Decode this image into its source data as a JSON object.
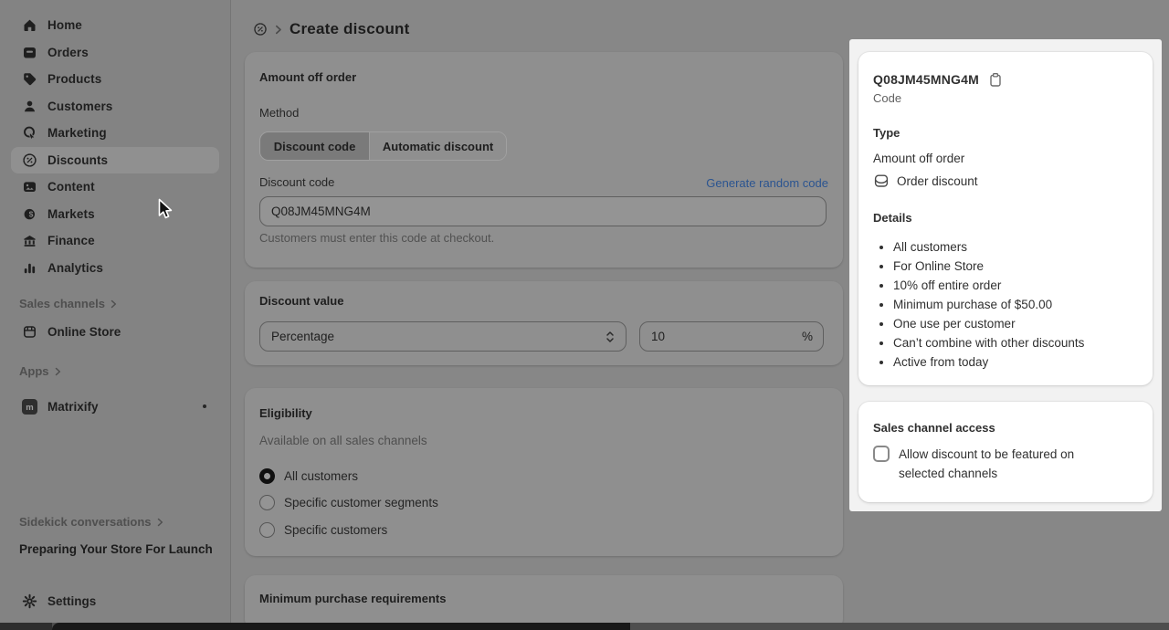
{
  "sidebar": {
    "nav": [
      {
        "label": "Home",
        "icon": "home-icon"
      },
      {
        "label": "Orders",
        "icon": "orders-icon"
      },
      {
        "label": "Products",
        "icon": "products-icon"
      },
      {
        "label": "Customers",
        "icon": "customers-icon"
      },
      {
        "label": "Marketing",
        "icon": "marketing-icon"
      },
      {
        "label": "Discounts",
        "icon": "discounts-icon",
        "active": true
      },
      {
        "label": "Content",
        "icon": "content-icon"
      },
      {
        "label": "Markets",
        "icon": "markets-icon"
      },
      {
        "label": "Finance",
        "icon": "finance-icon"
      },
      {
        "label": "Analytics",
        "icon": "analytics-icon"
      }
    ],
    "sales_channels_label": "Sales channels",
    "online_store_label": "Online Store",
    "apps_label": "Apps",
    "matrixify_label": "Matrixify",
    "sidekick_label": "Sidekick conversations",
    "sidekick_conversation": "Preparing Your Store For Launch",
    "settings_label": "Settings"
  },
  "header": {
    "title": "Create discount"
  },
  "amount_card": {
    "title": "Amount off order",
    "method_label": "Method",
    "segments": [
      {
        "label": "Discount code",
        "selected": true
      },
      {
        "label": "Automatic discount",
        "selected": false
      }
    ],
    "discount_code_label": "Discount code",
    "generate_link": "Generate random code",
    "code_value": "Q08JM45MNG4M",
    "helper": "Customers must enter this code at checkout."
  },
  "value_card": {
    "title": "Discount value",
    "select_value": "Percentage",
    "amount_value": "10",
    "unit": "%"
  },
  "eligibility_card": {
    "title": "Eligibility",
    "availability": "Available on all sales channels",
    "options": [
      {
        "label": "All customers",
        "selected": true
      },
      {
        "label": "Specific customer segments",
        "selected": false
      },
      {
        "label": "Specific customers",
        "selected": false
      }
    ]
  },
  "min_purchase_card": {
    "title": "Minimum purchase requirements"
  },
  "summary": {
    "code": "Q08JM45MNG4M",
    "code_caption": "Code",
    "type_label": "Type",
    "type_value": "Amount off order",
    "type_badge": "Order discount",
    "details_label": "Details",
    "details": [
      "All customers",
      "For Online Store",
      "10% off entire order",
      "Minimum purchase of $50.00",
      "One use per customer",
      "Can’t combine with other discounts",
      "Active from today"
    ],
    "sales_channel_access": {
      "title": "Sales channel access",
      "checkbox_label": "Allow discount to be featured on selected channels",
      "checked": false
    }
  },
  "colors": {
    "link_blue_dimmed": "#2b5490",
    "spotlight_background": "#f2f2f2",
    "dimmed_card_background": "#8f8f8f",
    "selected_radio": "#101010"
  }
}
